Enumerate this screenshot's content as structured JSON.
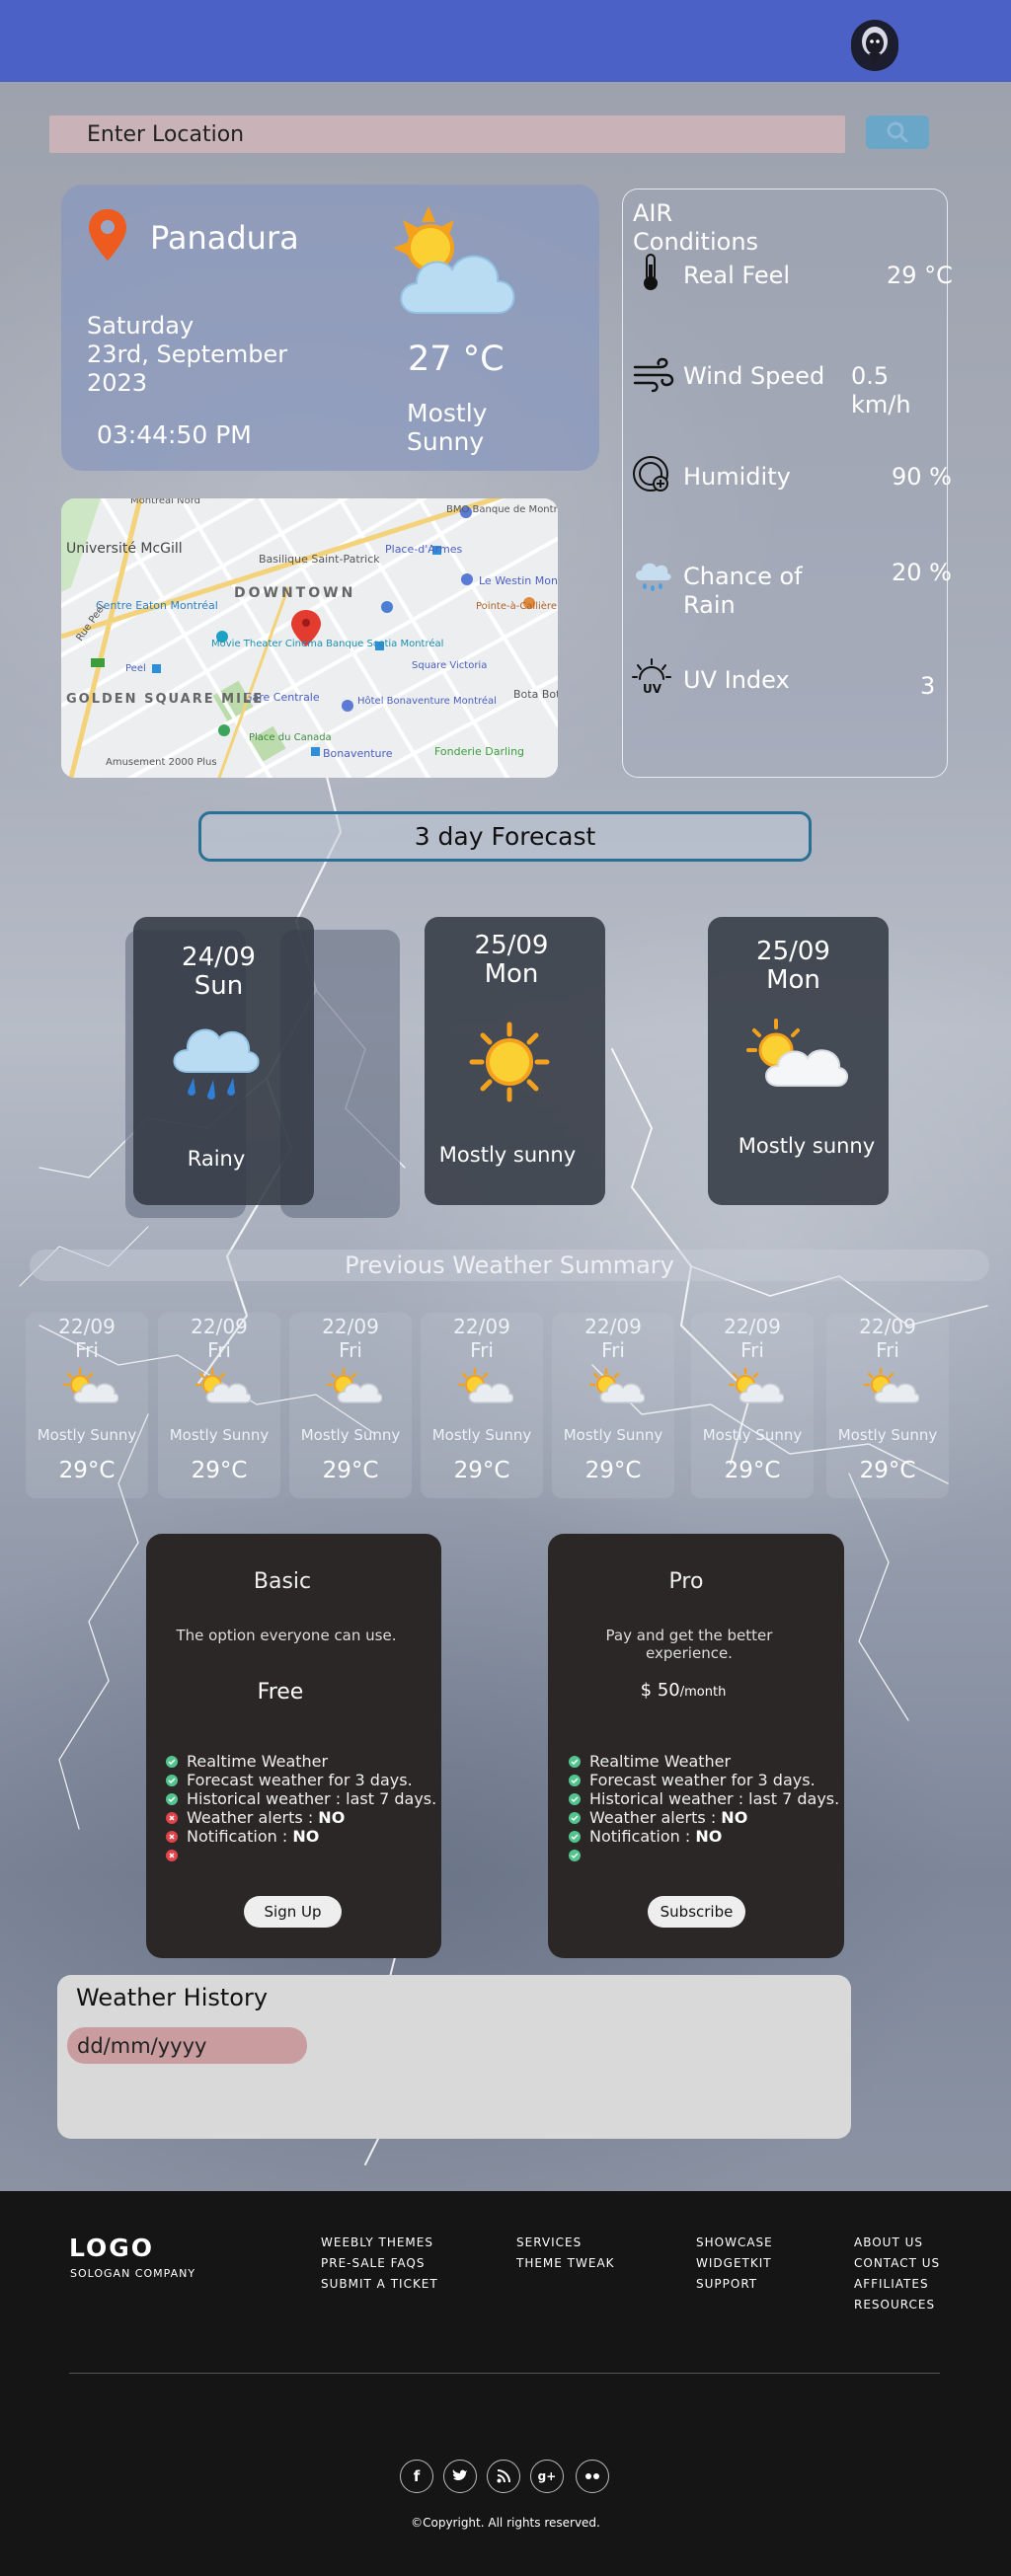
{
  "header": {
    "avatar_icon": "profile-avatar-icon"
  },
  "search": {
    "placeholder": "Enter Location",
    "button_icon": "search-icon"
  },
  "current": {
    "city": "Panadura",
    "day": "Saturday",
    "date": "23rd, September 2023",
    "time": "03:44:50 PM",
    "temperature": "27 °C",
    "condition": "Mostly Sunny",
    "icons": [
      "location-pin-icon",
      "partly-sunny-icon"
    ]
  },
  "air": {
    "title": "AIR Conditions",
    "items": [
      {
        "label": "Real Feel",
        "value": "29 °C",
        "icon": "thermometer-icon"
      },
      {
        "label": "Wind Speed",
        "value": "0.5 km/h",
        "icon": "wind-icon"
      },
      {
        "label": "Humidity",
        "value": "90 %",
        "icon": "humidity-gauge-icon"
      },
      {
        "label": "Chance of Rain",
        "value": "20 %",
        "icon": "rain-cloud-icon"
      },
      {
        "label": "UV Index",
        "value": "3",
        "icon": "uv-sun-icon"
      }
    ]
  },
  "map": {
    "labels": [
      "Montréal Nord",
      "BMO Banque de Montréal",
      "Université McGill",
      "Basilique Saint-Patrick",
      "Place-d'Armes",
      "Centre Eaton Montréal",
      "DOWNTOWN",
      "Le Westin Montréal",
      "Rue Peel",
      "Movie Theater Cinema Banque Scotia Montréal",
      "Square Victoria",
      "Pointe-à-Callière",
      "Peel",
      "Gare Centrale",
      "Hôtel Bonaventure Montréal",
      "Bota Bota",
      "GOLDEN SQUARE MILE",
      "Place du Canada",
      "Bonaventure",
      "Fonderie Darling",
      "Amusement 2000 Plus"
    ]
  },
  "forecast": {
    "button": "3 day Forecast",
    "days": [
      {
        "date": "24/09",
        "day": "Sun",
        "condition": "Rainy",
        "icon": "rain-cloud-icon"
      },
      {
        "date": "25/09",
        "day": "Mon",
        "condition": "Mostly sunny",
        "icon": "sun-icon"
      },
      {
        "date": "25/09",
        "day": "Mon",
        "condition": "Mostly sunny",
        "icon": "partly-sunny-icon"
      }
    ]
  },
  "previous": {
    "title": "Previous Weather Summary",
    "days": [
      {
        "date": "22/09",
        "day": "Fri",
        "condition": "Mostly Sunny",
        "temp": "29°C"
      },
      {
        "date": "22/09",
        "day": "Fri",
        "condition": "Mostly Sunny",
        "temp": "29°C"
      },
      {
        "date": "22/09",
        "day": "Fri",
        "condition": "Mostly Sunny",
        "temp": "29°C"
      },
      {
        "date": "22/09",
        "day": "Fri",
        "condition": "Mostly Sunny",
        "temp": "29°C"
      },
      {
        "date": "22/09",
        "day": "Fri",
        "condition": "Mostly Sunny",
        "temp": "29°C"
      },
      {
        "date": "22/09",
        "day": "Fri",
        "condition": "Mostly Sunny",
        "temp": "29°C"
      },
      {
        "date": "22/09",
        "day": "Fri",
        "condition": "Mostly Sunny",
        "temp": "29°C"
      }
    ]
  },
  "plans": {
    "basic": {
      "name": "Basic",
      "desc": "The option everyone can use.",
      "price": "Free",
      "features": [
        {
          "text": "Realtime Weather",
          "bold": "",
          "ok": true
        },
        {
          "text": "Forecast weather for 3 days.",
          "bold": "",
          "ok": true
        },
        {
          "text": "Historical weather : last 7 days.",
          "bold": "",
          "ok": true
        },
        {
          "text": "Weather alerts : ",
          "bold": "NO",
          "ok": false
        },
        {
          "text": "Notification : ",
          "bold": "NO",
          "ok": false
        }
      ],
      "button": "Sign Up"
    },
    "pro": {
      "name": "Pro",
      "desc": "Pay and get the better experience.",
      "price": "$ 50",
      "price_unit": "/month",
      "features": [
        {
          "text": "Realtime Weather",
          "bold": ""
        },
        {
          "text": "Forecast weather for 3 days.",
          "bold": ""
        },
        {
          "text": "Historical weather : last 7 days.",
          "bold": ""
        },
        {
          "text": "Weather alerts : ",
          "bold": "NO"
        },
        {
          "text": "Notification : ",
          "bold": "NO"
        }
      ],
      "button": "Subscribe"
    }
  },
  "history": {
    "title": "Weather History",
    "placeholder": "dd/mm/yyyy"
  },
  "footer": {
    "logo": "LOGO",
    "slogan": "SOLOGAN COMPANY",
    "columns": [
      [
        "WEEBLY THEMES",
        "PRE-SALE FAQS",
        "SUBMIT A TICKET"
      ],
      [
        "SERVICES",
        "THEME TWEAK"
      ],
      [
        "SHOWCASE",
        "WIDGETKIT",
        "SUPPORT"
      ],
      [
        "ABOUT US",
        "CONTACT US",
        "AFFILIATES",
        "RESOURCES"
      ]
    ],
    "social": [
      "f",
      "twitter-icon",
      "rss-icon",
      "google-plus-icon",
      "flickr-icon"
    ],
    "copyright": "©Copyright. All rights reserved."
  },
  "colors": {
    "topbar": "#4b61c6",
    "search_button": "#69a6c8",
    "plan_card": "#2b2727",
    "footer": "#151515"
  }
}
